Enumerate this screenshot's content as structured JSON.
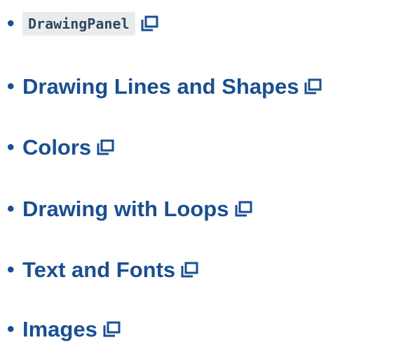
{
  "links": [
    {
      "label": "DrawingPanel",
      "style": "code",
      "icon": "external-window-icon"
    },
    {
      "label": "Drawing Lines and Shapes",
      "style": "text",
      "icon": "external-window-icon"
    },
    {
      "label": "Colors",
      "style": "text",
      "icon": "external-window-icon"
    },
    {
      "label": "Drawing with Loops",
      "style": "text",
      "icon": "external-window-icon"
    },
    {
      "label": "Text and Fonts",
      "style": "text",
      "icon": "external-window-icon"
    },
    {
      "label": "Images",
      "style": "text",
      "icon": "external-window-icon"
    }
  ],
  "colors": {
    "link": "#1a4f91",
    "code_bg": "#e9ecef",
    "code_text": "#33485e"
  }
}
